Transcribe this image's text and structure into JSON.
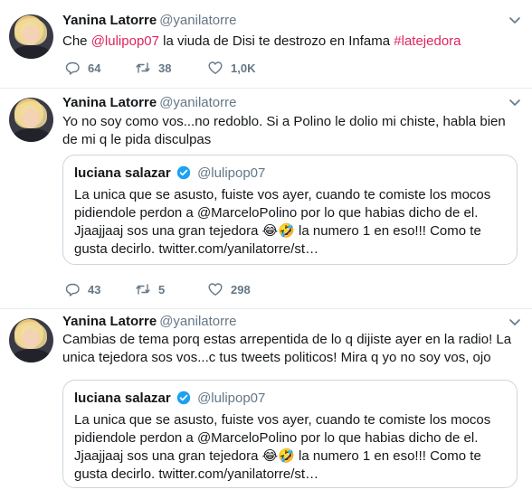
{
  "tweets": [
    {
      "name": "Yanina Latorre",
      "handle": "@yanilatorre",
      "text_parts": [
        "Che ",
        "@lulipop07",
        " la viuda de Disi te destrozo en Infama ",
        "#latejedora"
      ],
      "replies": "64",
      "retweets": "38",
      "likes": "1,0K"
    },
    {
      "name": "Yanina Latorre",
      "handle": "@yanilatorre",
      "text": "Yo no soy como vos...no redoblo. Si a Polino le dolio mi chiste, habla bien de mi q le pida disculpas",
      "quote": {
        "name": "luciana salazar",
        "handle": "@lulipop07",
        "text": "La unica que se asusto, fuiste vos ayer, cuando te comiste los mocos pidiendole perdon a @MarceloPolino por lo que  habias dicho de el. Jjaajjaaj sos una gran tejedora 😂🤣 la numero 1  en eso!!! Como te gusta decirlo. twitter.com/yanilatorre/st…"
      },
      "replies": "43",
      "retweets": "5",
      "likes": "298"
    },
    {
      "name": "Yanina Latorre",
      "handle": "@yanilatorre",
      "text": "Cambias de tema porq estas arrepentida de lo q dijiste ayer en la radio! La unica tejedora sos vos...c tus tweets politicos! Mira q yo no soy vos, ojo",
      "quote": {
        "name": "luciana salazar",
        "handle": "@lulipop07",
        "text": "La unica que se asusto, fuiste vos ayer, cuando te comiste los mocos pidiendole perdon a @MarceloPolino por lo que  habias dicho de el. Jjaajjaaj sos una gran tejedora 😂🤣 la numero 1  en eso!!! Como te gusta decirlo. twitter.com/yanilatorre/st…"
      }
    }
  ],
  "colors": {
    "link": "#e0245e",
    "muted": "#657786",
    "border": "#e6ecf0",
    "verified": "#1da1f2"
  },
  "icons": {
    "reply": "reply-icon",
    "retweet": "retweet-icon",
    "like": "heart-icon",
    "menu": "chevron-down-icon",
    "verified": "verified-badge-icon"
  }
}
